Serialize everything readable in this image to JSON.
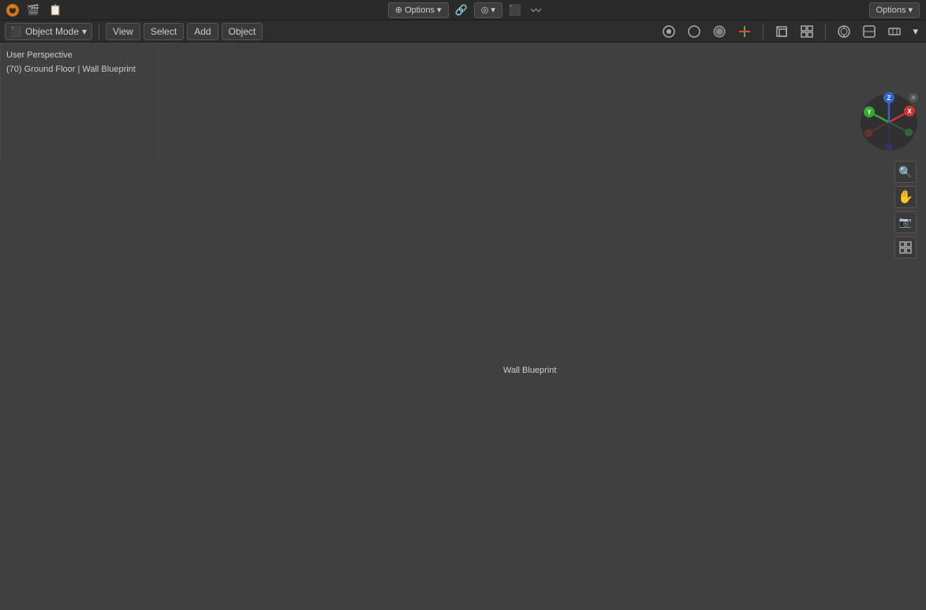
{
  "topbar": {
    "logo": "⬡",
    "scene_icon": "🎬",
    "engine": "Options",
    "center_icons": [
      "cursor",
      "move",
      "global",
      "snap",
      "proportional",
      "shading"
    ]
  },
  "header": {
    "mode_label": "Object Mode",
    "mode_dropdown_arrow": "▾",
    "view_label": "View",
    "select_label": "Select",
    "add_label": "Add",
    "object_label": "Object"
  },
  "viewport": {
    "perspective_label": "User Perspective",
    "scene_label": "(70) Ground Floor | Wall Blueprint",
    "object_name": "Wall Blueprint"
  },
  "options_button": "Options"
}
